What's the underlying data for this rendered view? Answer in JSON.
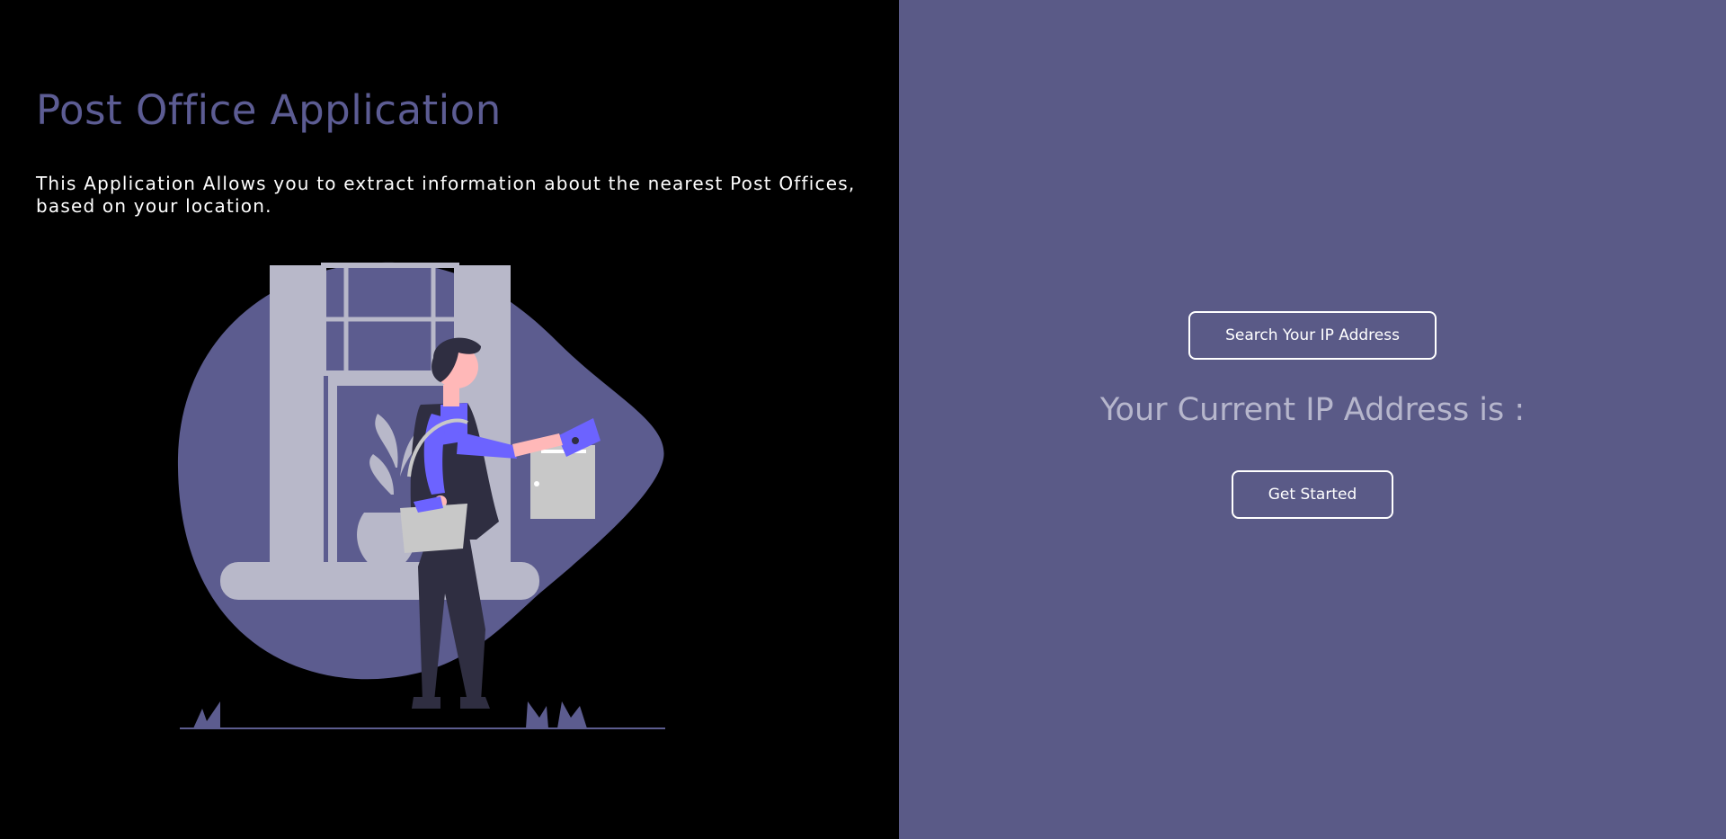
{
  "app": {
    "title": "Post Office Application",
    "description": "This Application Allows you to extract information about the nearest Post Offices, based on your location."
  },
  "illustration": {
    "icon": "person-mailing-letter-illustration"
  },
  "ip_panel": {
    "search_button_label": "Search Your IP Address",
    "ip_label": "Your Current IP Address is :",
    "get_started_label": "Get Started"
  },
  "colors": {
    "left_background": "#000000",
    "right_background": "#5a5a87",
    "accent": "#5c5c93",
    "illustration_purple": "#6c63ff"
  }
}
